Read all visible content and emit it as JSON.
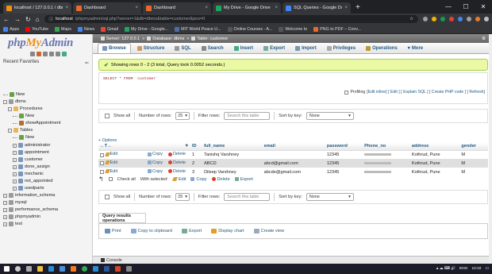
{
  "browser": {
    "tabs": [
      {
        "title": "localhost / 127.0.0.1 / dbms",
        "color": "#f29111",
        "active": true
      },
      {
        "title": "Dashboard",
        "color": "#e8692b",
        "active": false
      },
      {
        "title": "Dashboard",
        "color": "#e8692b",
        "active": false
      },
      {
        "title": "My Drive - Google Drive",
        "color": "#1fa463",
        "active": false
      },
      {
        "title": "SQL Queries - Google Docs",
        "color": "#4285f4",
        "active": false
      }
    ],
    "newtab": "+",
    "controls": {
      "minimize": "—",
      "maximize": "☐",
      "close": "✕"
    },
    "url_host": "localhost",
    "url_path": "/phpmyadmin/sql.php?server=1&db=dbms&table=customer&pos=0",
    "bookmarks": [
      {
        "label": "Apps",
        "color": "#4285f4"
      },
      {
        "label": "YouTube",
        "color": "#ff0000"
      },
      {
        "label": "Maps",
        "color": "#34a853"
      },
      {
        "label": "News",
        "color": "#4285f4"
      },
      {
        "label": "Gmail",
        "color": "#ea4335"
      },
      {
        "label": "My Drive - Google...",
        "color": "#1fa463"
      },
      {
        "label": "MIT World Peace U...",
        "color": "#4a6fa5"
      },
      {
        "label": "Online Courses - A...",
        "color": "#555555"
      },
      {
        "label": "Welcome to",
        "color": "#555555"
      },
      {
        "label": "PNG to PDF – Conv...",
        "color": "#e8692b"
      }
    ]
  },
  "sidebar": {
    "logo": {
      "php": "php",
      "my": "My",
      "admin": "Admin"
    },
    "recent": "Recent",
    "favorites": "Favorites",
    "tree": [
      {
        "label": "New",
        "icon": "new",
        "level": 0
      },
      {
        "label": "dbms",
        "icon": "db",
        "level": 0
      },
      {
        "label": "Procedures",
        "icon": "folder",
        "level": 1
      },
      {
        "label": "New",
        "icon": "new",
        "level": 2
      },
      {
        "label": "showAppointment",
        "icon": "proc",
        "level": 2
      },
      {
        "label": "Tables",
        "icon": "folder",
        "level": 1
      },
      {
        "label": "New",
        "icon": "new",
        "level": 2
      },
      {
        "label": "administrator",
        "icon": "table",
        "level": 2
      },
      {
        "label": "appointment",
        "icon": "table",
        "level": 2
      },
      {
        "label": "customer",
        "icon": "table",
        "level": 2
      },
      {
        "label": "done_assign",
        "icon": "table",
        "level": 2
      },
      {
        "label": "mechanic",
        "icon": "table",
        "level": 2
      },
      {
        "label": "not_appointed",
        "icon": "table",
        "level": 2
      },
      {
        "label": "usedparts",
        "icon": "table",
        "level": 2
      },
      {
        "label": "information_schema",
        "icon": "db",
        "level": 0
      },
      {
        "label": "mysql",
        "icon": "db",
        "level": 0
      },
      {
        "label": "performance_schema",
        "icon": "db",
        "level": 0
      },
      {
        "label": "phpmyadmin",
        "icon": "db",
        "level": 0
      },
      {
        "label": "test",
        "icon": "db",
        "level": 0
      }
    ]
  },
  "main": {
    "breadcrumb": {
      "server": "Server: 127.0.0.1",
      "database": "Database: dbms",
      "table": "Table: customer"
    },
    "tabs": [
      "Browse",
      "Structure",
      "SQL",
      "Search",
      "Insert",
      "Export",
      "Import",
      "Privileges",
      "Operations",
      "More"
    ],
    "success": "Showing rows 0 - 2 (3 total, Query took 0.0052 seconds.)",
    "sql": {
      "kw1": "SELECT",
      "star": "*",
      "kw2": "FROM",
      "table": "`customer`"
    },
    "profiling": "Profiling",
    "sql_links": "[Edit inline] [ Edit ] [ Explain SQL ] [ Create PHP code ] [ Refresh]",
    "nav": {
      "show_all": "Show all",
      "rows_label": "Number of rows:",
      "rows_value": "25",
      "filter_label": "Filter rows:",
      "filter_placeholder": "Search this table",
      "sort_label": "Sort by key:",
      "sort_value": "None"
    },
    "options": "+ Options",
    "columns": [
      "ID",
      "full_name",
      "email",
      "password",
      "Phone_no",
      "address",
      "gender"
    ],
    "actions": {
      "edit": "Edit",
      "copy": "Copy",
      "delete": "Delete"
    },
    "rows": [
      {
        "id": "1",
        "full_name": "Tanishq Varshney",
        "email": "",
        "password": "12345",
        "address": "Kothrud, Pune",
        "gender": "M"
      },
      {
        "id": "2",
        "full_name": "ABCD",
        "email": "abcd@gmail.com",
        "password": "12345",
        "address": "Kothrud, Pune",
        "gender": "M"
      },
      {
        "id": "3",
        "full_name": "Dileep Varshney",
        "email": "abcde@gmail.com",
        "password": "12345",
        "address": "Kothrud, Pune",
        "gender": "M"
      }
    ],
    "bulk": {
      "check_all": "Check all",
      "with_selected": "With selected:",
      "edit": "Edit",
      "copy": "Copy",
      "delete": "Delete",
      "export": "Export"
    },
    "qro_title": "Query results operations",
    "qro": [
      "Print",
      "Copy to clipboard",
      "Export",
      "Display chart",
      "Create view"
    ],
    "console": "Console"
  },
  "taskbar": {
    "clock": "12:22",
    "lang": "ENG"
  }
}
